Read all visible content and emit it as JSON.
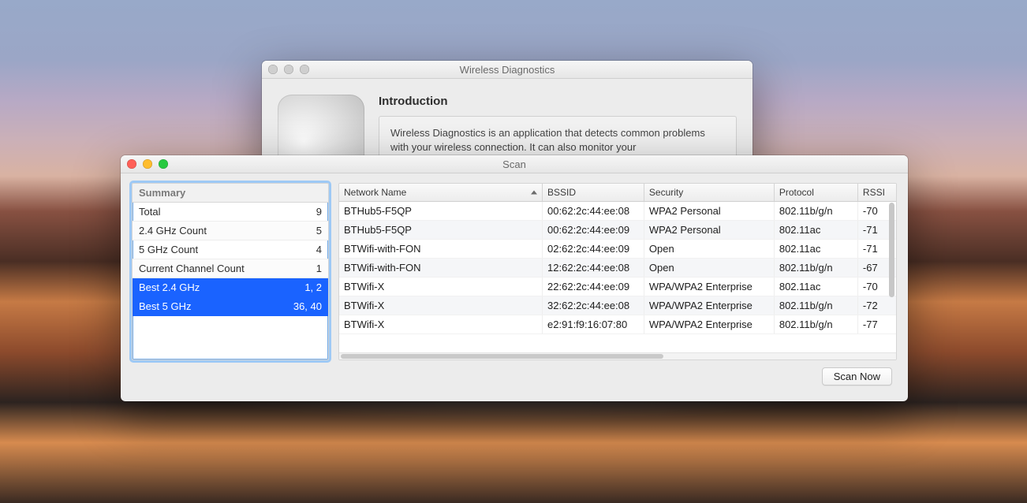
{
  "back_window": {
    "title": "Wireless Diagnostics",
    "intro_heading": "Introduction",
    "intro_text": "Wireless Diagnostics is an application that detects common problems with your wireless connection. It can also monitor your"
  },
  "scan_window": {
    "title": "Scan",
    "scan_button": "Scan Now"
  },
  "summary": {
    "heading": "Summary",
    "rows": [
      {
        "label": "Total",
        "value": "9",
        "selected": false
      },
      {
        "label": "2.4 GHz Count",
        "value": "5",
        "selected": false
      },
      {
        "label": "5 GHz Count",
        "value": "4",
        "selected": false
      },
      {
        "label": "Current Channel Count",
        "value": "1",
        "selected": false
      },
      {
        "label": "Best 2.4 GHz",
        "value": "1, 2",
        "selected": true
      },
      {
        "label": "Best 5 GHz",
        "value": "36, 40",
        "selected": true
      }
    ]
  },
  "table": {
    "columns": {
      "name": "Network Name",
      "bssid": "BSSID",
      "security": "Security",
      "protocol": "Protocol",
      "rssi": "RSSI"
    },
    "rows": [
      {
        "name": "BTHub5-F5QP",
        "bssid": "00:62:2c:44:ee:08",
        "security": "WPA2 Personal",
        "protocol": "802.11b/g/n",
        "rssi": "-70"
      },
      {
        "name": "BTHub5-F5QP",
        "bssid": "00:62:2c:44:ee:09",
        "security": "WPA2 Personal",
        "protocol": "802.11ac",
        "rssi": "-71"
      },
      {
        "name": "BTWifi-with-FON",
        "bssid": "02:62:2c:44:ee:09",
        "security": "Open",
        "protocol": "802.11ac",
        "rssi": "-71"
      },
      {
        "name": "BTWifi-with-FON",
        "bssid": "12:62:2c:44:ee:08",
        "security": "Open",
        "protocol": "802.11b/g/n",
        "rssi": "-67"
      },
      {
        "name": "BTWifi-X",
        "bssid": "22:62:2c:44:ee:09",
        "security": "WPA/WPA2 Enterprise",
        "protocol": "802.11ac",
        "rssi": "-70"
      },
      {
        "name": "BTWifi-X",
        "bssid": "32:62:2c:44:ee:08",
        "security": "WPA/WPA2 Enterprise",
        "protocol": "802.11b/g/n",
        "rssi": "-72"
      },
      {
        "name": "BTWifi-X",
        "bssid": "e2:91:f9:16:07:80",
        "security": "WPA/WPA2 Enterprise",
        "protocol": "802.11b/g/n",
        "rssi": "-77"
      }
    ]
  }
}
